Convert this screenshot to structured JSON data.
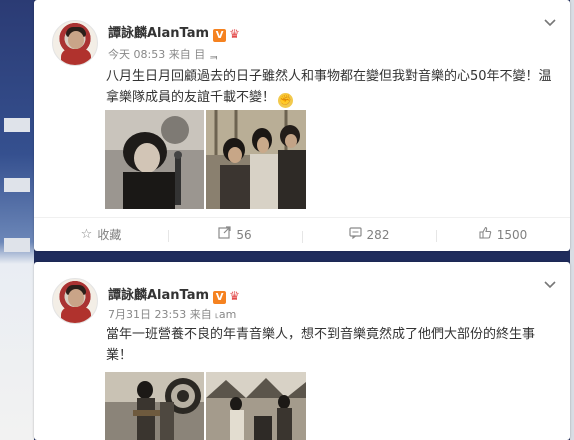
{
  "posts": [
    {
      "author": "譚詠麟AlanTam",
      "verified_badge": "V",
      "crown": "♛",
      "meta": "今天 08:53 来自 ⽬ ᆿ",
      "text": "八月生日月回顧過去的日子雖然人和事物都在變但我對音樂的心50年不變！温拿樂隊成員的友誼千載不變！",
      "emoji": "💪",
      "actions": {
        "favorite": "收藏",
        "repost": "56",
        "comment": "282",
        "like": "1500"
      }
    },
    {
      "author": "譚詠麟AlanTam",
      "verified_badge": "V",
      "crown": "♛",
      "meta": "7月31日 23:53 来自 ˪am",
      "text": "當年一班營養不良的年青音樂人，想不到音樂竟然成了他們大部份的終生事業！"
    }
  ],
  "icons": {
    "chevron": "chevron-down-icon",
    "favorite": "star-icon",
    "repost": "share-icon",
    "comment": "comment-icon",
    "like": "thumbs-up-icon"
  },
  "colors": {
    "background": "#1f2c5c",
    "card": "#ffffff",
    "badge": "#f58220",
    "text": "#333333",
    "meta": "#888888"
  }
}
